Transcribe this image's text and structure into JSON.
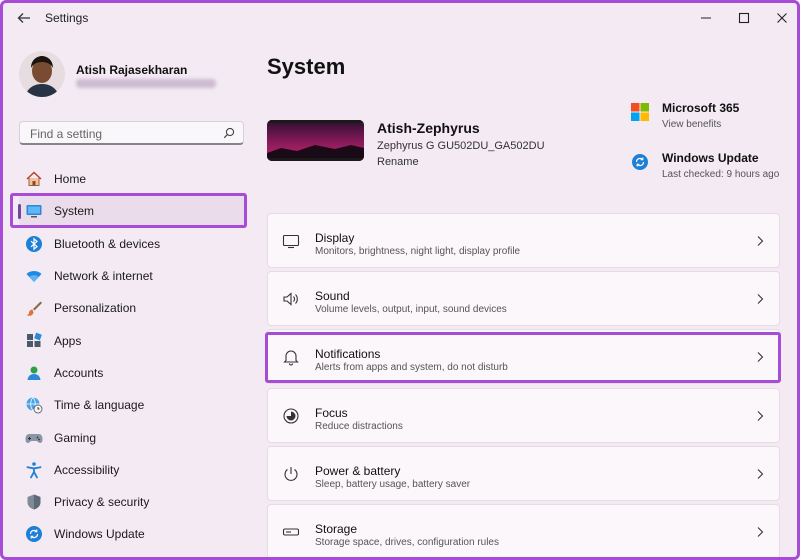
{
  "window": {
    "title": "Settings"
  },
  "profile": {
    "name": "Atish Rajasekharan"
  },
  "search": {
    "placeholder": "Find a setting"
  },
  "sidebar": {
    "items": [
      {
        "label": "Home",
        "icon": "home-icon"
      },
      {
        "label": "System",
        "icon": "system-icon",
        "active": true
      },
      {
        "label": "Bluetooth & devices",
        "icon": "bluetooth-icon"
      },
      {
        "label": "Network & internet",
        "icon": "wifi-icon"
      },
      {
        "label": "Personalization",
        "icon": "brush-icon"
      },
      {
        "label": "Apps",
        "icon": "apps-icon"
      },
      {
        "label": "Accounts",
        "icon": "accounts-icon"
      },
      {
        "label": "Time & language",
        "icon": "globe-clock-icon"
      },
      {
        "label": "Gaming",
        "icon": "gamepad-icon"
      },
      {
        "label": "Accessibility",
        "icon": "accessibility-icon"
      },
      {
        "label": "Privacy & security",
        "icon": "shield-icon"
      },
      {
        "label": "Windows Update",
        "icon": "update-icon"
      }
    ]
  },
  "main": {
    "title": "System",
    "device": {
      "name": "Atish-Zephyrus",
      "model": "Zephyrus G GU502DU_GA502DU",
      "rename_label": "Rename"
    },
    "promos": [
      {
        "title": "Microsoft 365",
        "subtitle": "View benefits",
        "icon": "microsoft-logo-icon"
      },
      {
        "title": "Windows Update",
        "subtitle": "Last checked: 9 hours ago",
        "icon": "update-icon"
      }
    ],
    "cards": [
      {
        "title": "Display",
        "subtitle": "Monitors, brightness, night light, display profile",
        "icon": "monitor-icon"
      },
      {
        "title": "Sound",
        "subtitle": "Volume levels, output, input, sound devices",
        "icon": "speaker-icon"
      },
      {
        "title": "Notifications",
        "subtitle": "Alerts from apps and system, do not disturb",
        "icon": "bell-icon"
      },
      {
        "title": "Focus",
        "subtitle": "Reduce distractions",
        "icon": "focus-icon"
      },
      {
        "title": "Power & battery",
        "subtitle": "Sleep, battery usage, battery saver",
        "icon": "power-icon"
      },
      {
        "title": "Storage",
        "subtitle": "Storage space, drives, configuration rules",
        "icon": "storage-icon"
      }
    ]
  },
  "colors": {
    "highlight": "#a64cd6",
    "accent": "#0067c0",
    "background": "#f3eaf3"
  }
}
